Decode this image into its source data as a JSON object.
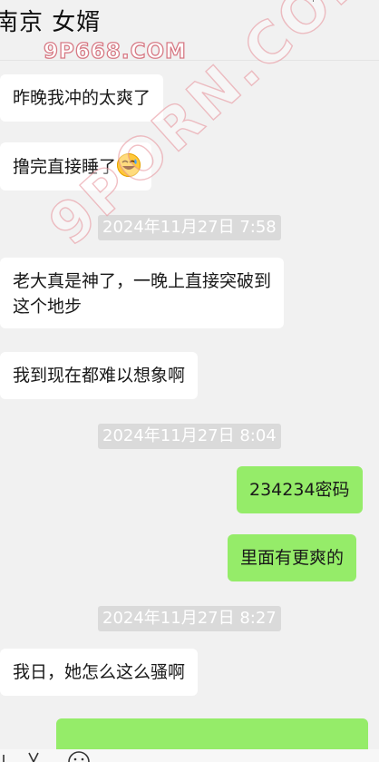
{
  "header": {
    "title": "南京  女婿"
  },
  "watermark": {
    "top_text": "9P668.COM",
    "diagonal_text": "9PORN.COM"
  },
  "messages": [
    {
      "kind": "in",
      "text": "昨晚我冲的太爽了"
    },
    {
      "kind": "in",
      "text": "撸完直接睡了",
      "emoji": "sweat-laugh-icon"
    },
    {
      "kind": "time",
      "text": "2024年11月27日 7:58"
    },
    {
      "kind": "in",
      "text_line1": "老大真是神了，一晚上直接突破到",
      "text_line2": "这个地步"
    },
    {
      "kind": "in",
      "text": "我到现在都难以想象啊"
    },
    {
      "kind": "time",
      "text": "2024年11月27日 8:04"
    },
    {
      "kind": "out",
      "text": "234234密码"
    },
    {
      "kind": "out",
      "text": "里面有更爽的"
    },
    {
      "kind": "time",
      "text": "2024年11月27日 8:27"
    },
    {
      "kind": "in",
      "text": "我日，她怎么这么骚啊"
    }
  ],
  "colors": {
    "incoming_bubble": "#ffffff",
    "outgoing_bubble": "#95ec69",
    "timestamp_bg": "#dadada",
    "background": "#f1f1f1"
  }
}
